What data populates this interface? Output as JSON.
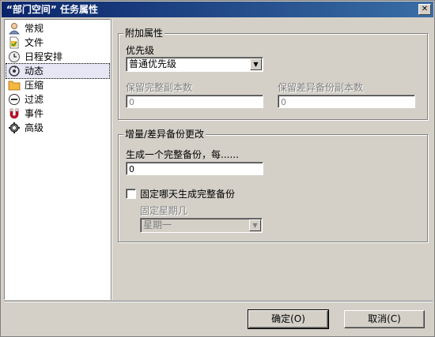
{
  "window": {
    "title": "“部门空间” 任务属性",
    "close_glyph": "✕"
  },
  "nav": {
    "items": [
      {
        "label": "常规",
        "icon": "user-icon"
      },
      {
        "label": "文件",
        "icon": "file-icon"
      },
      {
        "label": "日程安排",
        "icon": "clock-icon"
      },
      {
        "label": "动态",
        "icon": "refresh-icon",
        "selected": true
      },
      {
        "label": "压缩",
        "icon": "folder-icon"
      },
      {
        "label": "过滤",
        "icon": "minus-circle-icon"
      },
      {
        "label": "事件",
        "icon": "magnet-icon"
      },
      {
        "label": "高级",
        "icon": "gear-icon"
      }
    ]
  },
  "extra": {
    "title": "附加属性",
    "priority_label": "优先级",
    "priority_value": "普通优先级",
    "keep_full_label": "保留完整副本数",
    "keep_full_value": "0",
    "keep_diff_label": "保留差异备份副本数",
    "keep_diff_value": "0"
  },
  "incremental": {
    "title": "增量/差异备份更改",
    "every_label": "生成一个完整备份，每......",
    "every_value": "0",
    "fixed_day_label": "固定哪天生成完整备份",
    "fixed_day_checked": false,
    "weekday_label": "固定星期几",
    "weekday_value": "星期一"
  },
  "buttons": {
    "ok": "确定(O)",
    "cancel": "取消(C)"
  },
  "colors": {
    "titlebar_start": "#0a246a",
    "titlebar_end": "#3a6ea5",
    "selection": "#e7e6f4",
    "face": "#d4d0c8"
  }
}
